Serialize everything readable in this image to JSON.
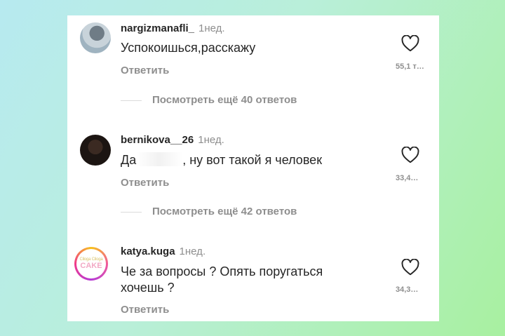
{
  "comments": [
    {
      "username": "nargizmanafli_",
      "time": "1нед.",
      "text": "Успокоишься,расскажу",
      "reply_label": "Ответить",
      "likes": "55,1 т…"
    },
    {
      "username": "bernikova__26",
      "time": "1нед.",
      "text_before": "Да",
      "text_after": ", ну вот такой я человек",
      "reply_label": "Ответить",
      "likes": "33,4…"
    },
    {
      "username": "katya.kuga",
      "time": "1нед.",
      "avatar_logo_top": "Ciloga Ciloga",
      "avatar_logo_main": "CAKE",
      "text": "Че за вопросы ? Опять поругаться хочешь ?",
      "reply_label": "Ответить",
      "likes": "34,3…"
    }
  ],
  "view_more": [
    "Посмотреть ещё 40 ответов",
    "Посмотреть ещё 42 ответов"
  ],
  "colors": {
    "text": "#262626",
    "secondary": "#8e8e8e",
    "divider": "#dbdbdb"
  }
}
